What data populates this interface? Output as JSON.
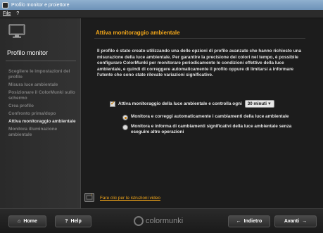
{
  "window": {
    "title": "Profilo monitor e proiettore"
  },
  "menu": {
    "file": "File",
    "help": "?"
  },
  "sidebar": {
    "heading": "Profilo monitor",
    "steps": [
      {
        "label": "Scegliere le impostazioni del profilo",
        "active": false
      },
      {
        "label": "Misura luce ambientale",
        "active": false
      },
      {
        "label": "Posizionare il ColorMunki sullo schermo",
        "active": false
      },
      {
        "label": "Crea profilo",
        "active": false
      },
      {
        "label": "Confronto prima/dopo",
        "active": false
      },
      {
        "label": "Attiva monitoraggio ambientale",
        "active": true
      },
      {
        "label": "Monitora illuminazione ambientale",
        "active": false
      }
    ]
  },
  "main": {
    "title": "Attiva monitoraggio ambientale",
    "description": "Il profilo è stato creato utilizzando una delle opzioni di profilo avanzate che hanno richiesto una misurazione della luce ambientale. Per garantire la precisione dei colori nel tempo, è possibile configurare ColorMunki per monitorare periodicamente le condizioni effettive della luce ambientale, e quindi di correggere automaticamente il profilo oppure di limitarsi a informare l'utente che sono state rilevate variazioni significative.",
    "checkbox_label": "Attiva monitoraggio della luce ambientale e controlla ogni",
    "checkbox_checked": true,
    "interval_value": "30 minuti",
    "radio_1": "Monitora e correggi automaticamente i cambiamenti della luce ambientale",
    "radio_2": "Monitora e informa di cambiamenti significativi della luce ambientale senza eseguire altre operazioni",
    "video_link": "Fare clic per le istruzioni video"
  },
  "footer": {
    "home": "Home",
    "help": "Help",
    "brand": "colormunki",
    "back": "Indietro",
    "next": "Avanti"
  },
  "colors": {
    "accent": "#f2a619",
    "background": "#1c1c1c"
  }
}
